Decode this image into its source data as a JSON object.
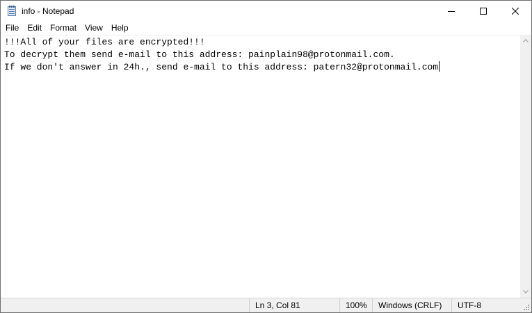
{
  "window": {
    "title": "info - Notepad"
  },
  "menu": {
    "items": [
      "File",
      "Edit",
      "Format",
      "View",
      "Help"
    ]
  },
  "editor": {
    "lines": [
      "!!!All of your files are encrypted!!!",
      "To decrypt them send e-mail to this address: painplain98@protonmail.com.",
      "If we don't answer in 24h., send e-mail to this address: patern32@protonmail.com"
    ]
  },
  "status": {
    "position": "Ln 3, Col 81",
    "zoom": "100%",
    "line_ending": "Windows (CRLF)",
    "encoding": "UTF-8"
  },
  "icons": {
    "app": "notepad-icon",
    "minimize": "minimize-icon",
    "maximize": "maximize-icon",
    "close": "close-icon",
    "scroll_up": "chevron-up-icon",
    "scroll_down": "chevron-down-icon",
    "grip": "resize-grip-icon"
  },
  "colors": {
    "statusbar_bg": "#f0f0f0",
    "window_border": "#6e6e6e"
  }
}
